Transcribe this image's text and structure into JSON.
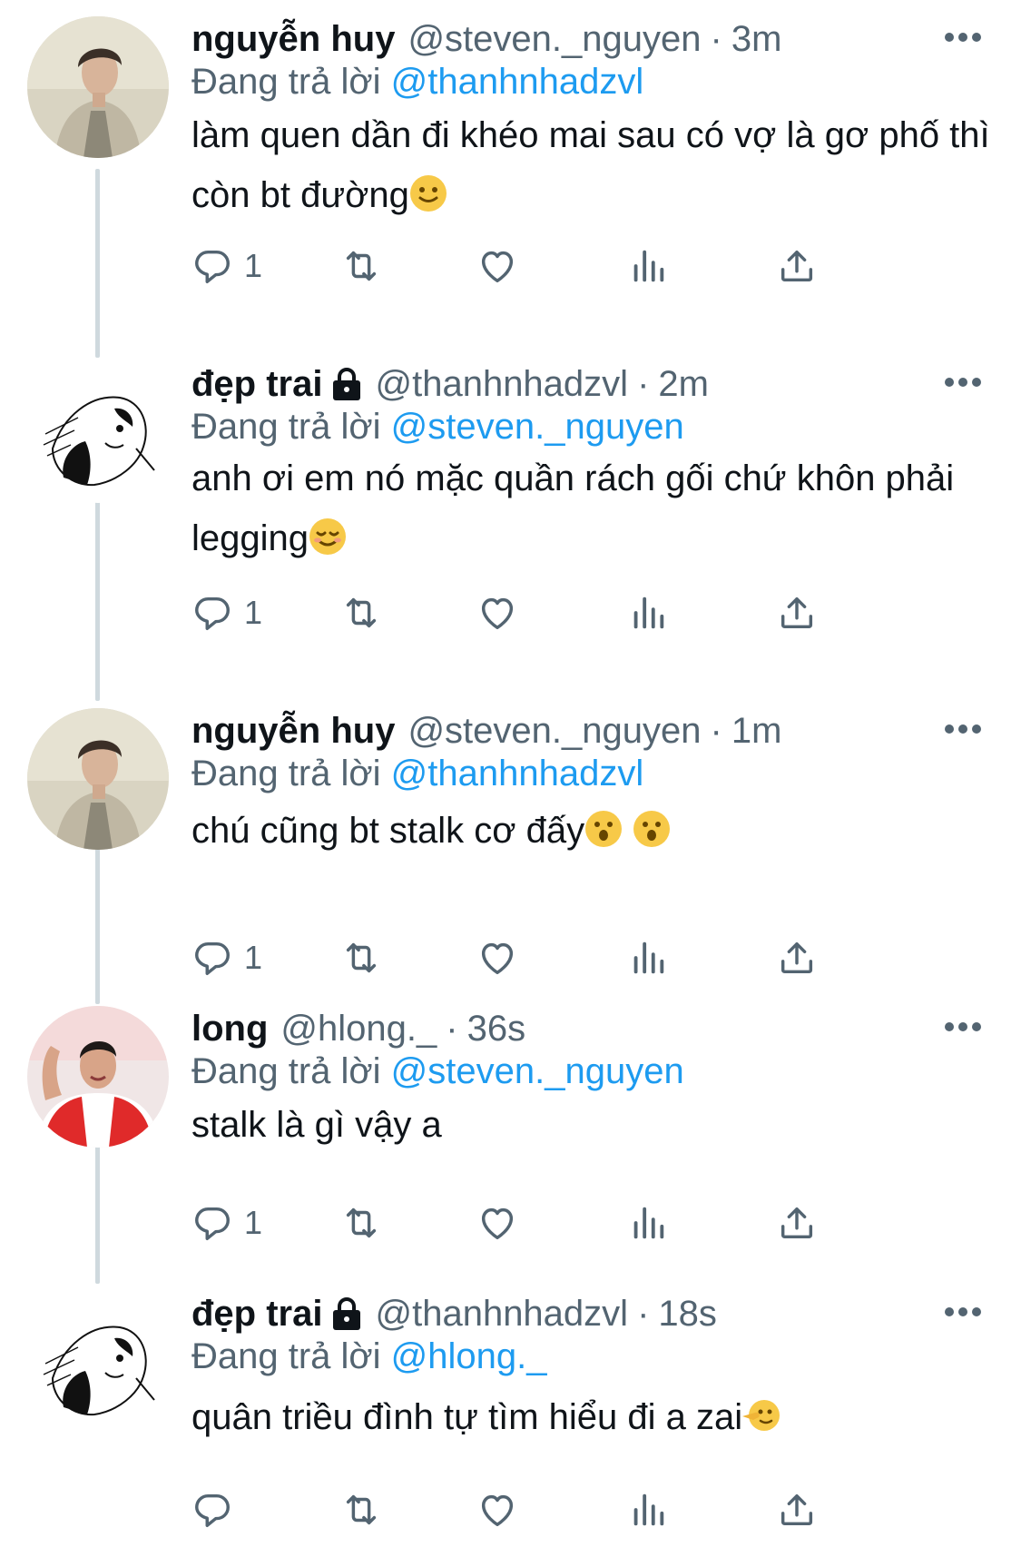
{
  "reply_prefix": "Đang trả lời",
  "colors": {
    "accent": "#1d9bf0",
    "muted": "#536471",
    "text": "#0f1419",
    "thread_line": "#cfd9de"
  },
  "tweets": [
    {
      "name": "nguyễn huy",
      "handle": "@steven._nguyen",
      "time": "3m",
      "locked": false,
      "reply_to": "@thanhnhadzvl",
      "text": "làm quen dần đi khéo mai sau có vợ là gơ phố thì còn bt đường",
      "emoji": [
        "slightly-smiling-face"
      ],
      "replies": "1"
    },
    {
      "name": "đẹp trai",
      "handle": "@thanhnhadzvl",
      "time": "2m",
      "locked": true,
      "reply_to": "@steven._nguyen",
      "text": "anh ơi em nó mặc quần rách gối chứ khôn phải legging",
      "emoji": [
        "relieved-face"
      ],
      "replies": "1"
    },
    {
      "name": "nguyễn huy",
      "handle": "@steven._nguyen",
      "time": "1m",
      "locked": false,
      "reply_to": "@thanhnhadzvl",
      "text": "chú cũng bt stalk cơ đấy",
      "emoji": [
        "hushed-face",
        "hushed-face"
      ],
      "replies": "1"
    },
    {
      "name": "long",
      "handle": "@hlong._",
      "time": "36s",
      "locked": false,
      "reply_to": "@steven._nguyen",
      "text": "stalk là gì vậy a",
      "emoji": [],
      "replies": "1"
    },
    {
      "name": "đẹp trai",
      "handle": "@thanhnhadzvl",
      "time": "18s",
      "locked": true,
      "reply_to": "@hlong._",
      "text": "quân triều đình tự tìm hiểu đi a zai",
      "emoji": [
        "face-pointing-left"
      ],
      "replies": ""
    }
  ],
  "action_icons": [
    "reply-icon",
    "retweet-icon",
    "like-icon",
    "views-icon",
    "share-icon"
  ]
}
